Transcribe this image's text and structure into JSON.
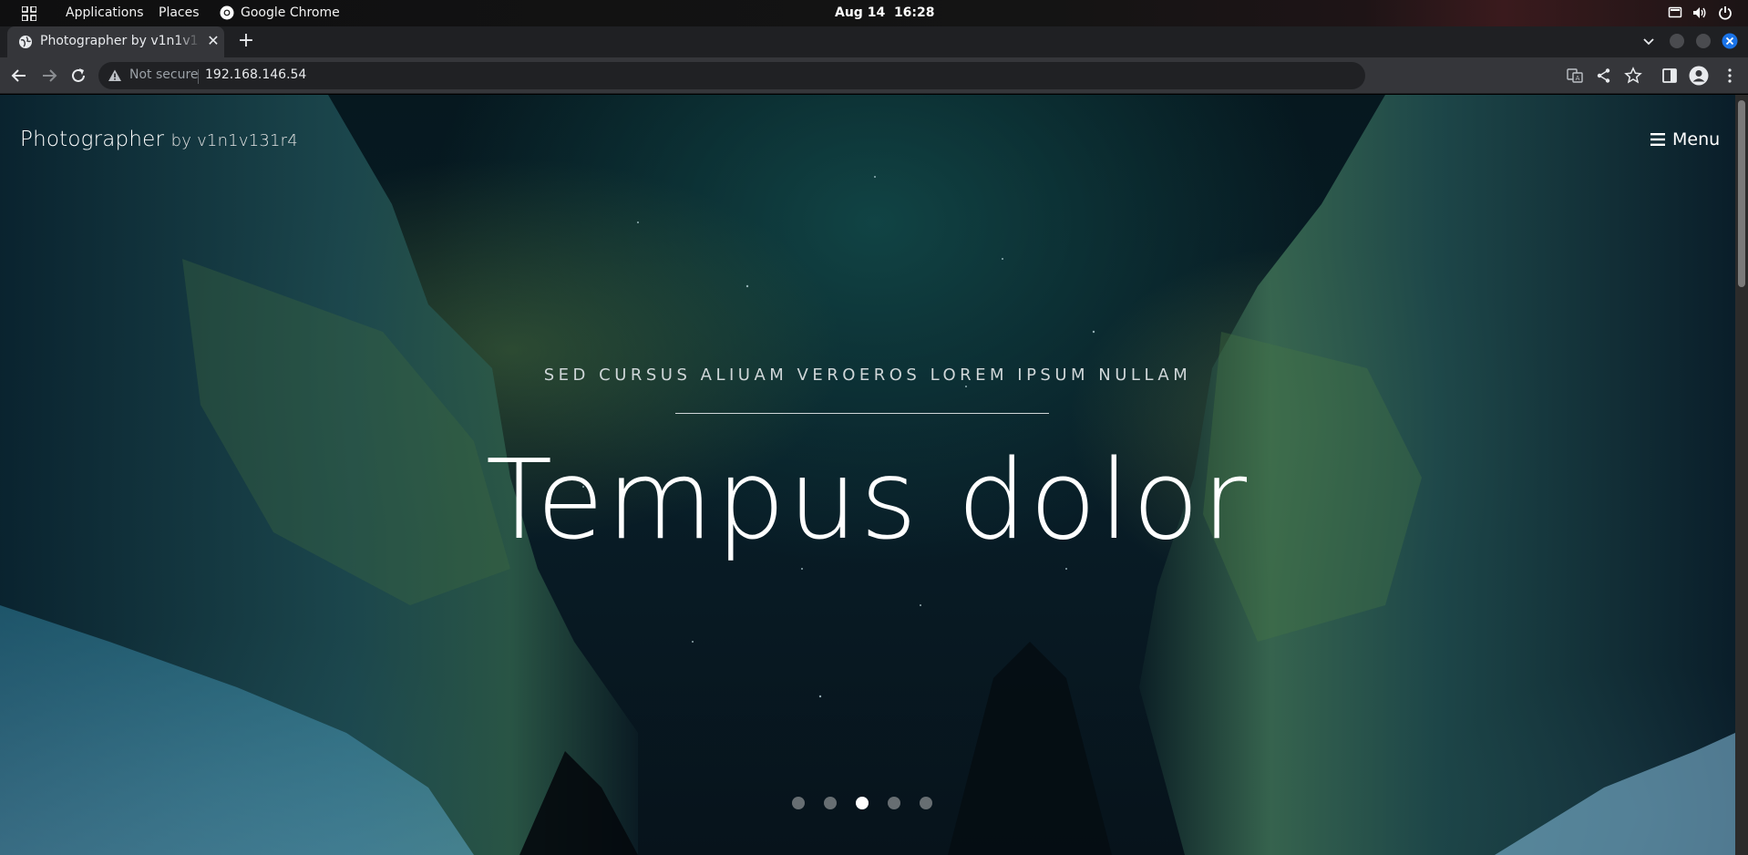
{
  "system_bar": {
    "applications": "Applications",
    "places": "Places",
    "app_name": "Google Chrome",
    "date": "Aug 14",
    "time": "16:28"
  },
  "browser": {
    "tab_title": "Photographer by v1n1v131r4",
    "security_label": "Not secure",
    "url": "192.168.146.54"
  },
  "page": {
    "brand_name": "Photographer",
    "brand_by": "by v1n1v131r4",
    "menu_label": "Menu",
    "tagline": "SED CURSUS ALIUAM VEROEROS LOREM IPSUM NULLAM",
    "hero_title": "Tempus dolor",
    "slider": {
      "slide_count": 5,
      "active_index": 2
    }
  },
  "colors": {
    "accent_close": "#1a73e8",
    "text": "#ffffff"
  }
}
